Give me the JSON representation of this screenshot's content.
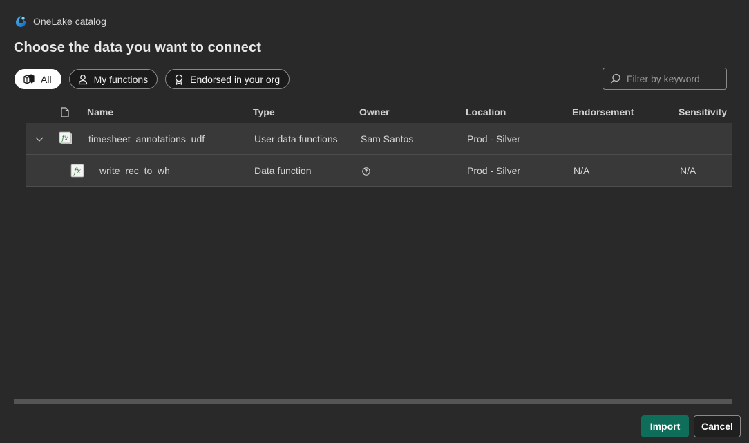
{
  "header": {
    "app_name": "OneLake catalog",
    "title": "Choose the data you want to connect"
  },
  "filters": [
    {
      "label": "All",
      "icon": "cubes-icon",
      "active": true
    },
    {
      "label": "My functions",
      "icon": "person-icon",
      "active": false
    },
    {
      "label": "Endorsed in your org",
      "icon": "ribbon-icon",
      "active": false
    }
  ],
  "search": {
    "placeholder": "Filter by keyword",
    "value": ""
  },
  "table": {
    "columns": {
      "name": "Name",
      "type": "Type",
      "owner": "Owner",
      "location": "Location",
      "endorsement": "Endorsement",
      "sensitivity": "Sensitivity"
    },
    "rows": [
      {
        "name": "timesheet_annotations_udf",
        "type": "User data functions",
        "owner": "Sam Santos",
        "location": "Prod - Silver",
        "endorsement": "—",
        "sensitivity": "—"
      },
      {
        "name": "write_rec_to_wh",
        "type": "Data function",
        "owner": "",
        "location": "Prod - Silver",
        "endorsement": "N/A",
        "sensitivity": "N/A"
      }
    ]
  },
  "footer": {
    "import_label": "Import",
    "cancel_label": "Cancel"
  },
  "colors": {
    "background": "#292929",
    "row_background": "#393939",
    "primary_button": "#0f6e5a"
  }
}
